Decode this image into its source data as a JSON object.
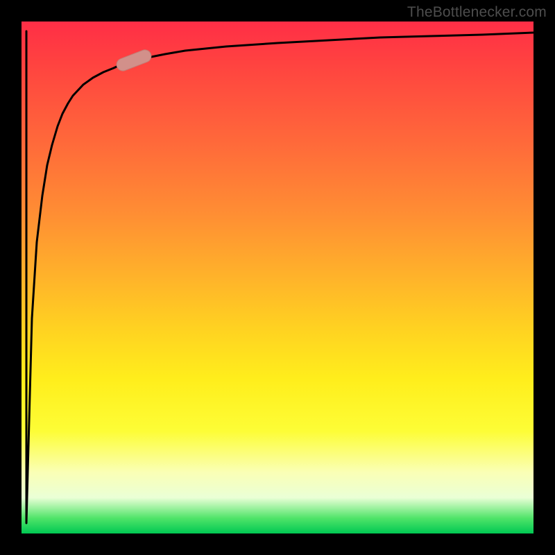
{
  "attribution": "TheBottlenecker.com",
  "colors": {
    "curve": "#000000",
    "marker_fill": "#d2908a",
    "marker_stroke": "#c37d76"
  },
  "chart_data": {
    "type": "line",
    "title": "",
    "xlabel": "",
    "ylabel": "",
    "xlim": [
      0,
      100
    ],
    "ylim": [
      0,
      100
    ],
    "grid": false,
    "series": [
      {
        "name": "bottleneck-curve",
        "x": [
          0,
          1,
          2,
          3,
          4,
          5,
          6,
          7,
          8,
          9,
          10,
          12,
          14,
          16,
          18,
          20,
          24,
          28,
          32,
          40,
          50,
          60,
          70,
          80,
          90,
          100
        ],
        "values": [
          0,
          98,
          40,
          55,
          64,
          70,
          74,
          77.5,
          80,
          82,
          83.5,
          85.5,
          87,
          88,
          89,
          90,
          91.2,
          92,
          92.7,
          93.5,
          94.2,
          94.8,
          95.3,
          95.7,
          96.0,
          96.3
        ]
      }
    ],
    "marker": {
      "x": 22,
      "y": 90.6,
      "angle_deg": -35
    }
  }
}
